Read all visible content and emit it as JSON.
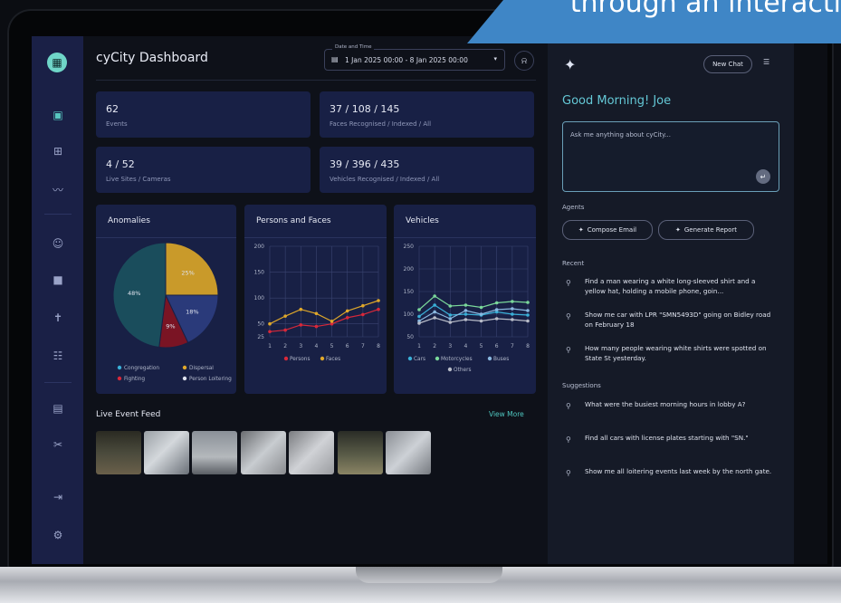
{
  "banner": {
    "text": "through an interacti"
  },
  "app": {
    "title": "cyCity Dashboard"
  },
  "sidebar": {
    "icons": [
      "building-icon",
      "dashboard-icon",
      "grid-icon",
      "trend-icon",
      "face-icon",
      "camera-icon",
      "person-icon",
      "loitering-icon",
      "report-icon",
      "tools-icon",
      "logout-icon",
      "settings-icon"
    ]
  },
  "header": {
    "date_label": "Date and Time",
    "date_value": "1 Jan 2025 00:00 - 8 Jan 2025 00:00"
  },
  "stats": [
    {
      "value": "62",
      "label": "Events"
    },
    {
      "value": "37 / 108 / 145",
      "label": "Faces Recognised / Indexed / All"
    },
    {
      "value": "4 / 52",
      "label": "Live Sites / Cameras"
    },
    {
      "value": "39 / 396 / 435",
      "label": "Vehicles Recognised / Indexed / All"
    }
  ],
  "cards": {
    "anomalies": "Anomalies",
    "persons": "Persons and Faces",
    "vehicles": "Vehicles"
  },
  "colors": {
    "congregation": "#1a4d5c",
    "dispersal": "#c99a2a",
    "fighting": "#7a1424",
    "loitering": "#2a3a7a",
    "persons": "#d8283a",
    "faces": "#e0a82a",
    "cars": "#3ab0d8",
    "motorcycles": "#7ad89a",
    "buses": "#8ab8e0",
    "others": "#b8bcc8"
  },
  "chart_data": [
    {
      "type": "pie",
      "title": "Anomalies",
      "labels": [
        "Congregation",
        "Dispersal",
        "Fighting",
        "Person Loitering"
      ],
      "values": [
        48,
        25,
        9,
        18
      ]
    },
    {
      "type": "line",
      "title": "Persons and Faces",
      "x": [
        1,
        2,
        3,
        4,
        5,
        6,
        7,
        8
      ],
      "ylim": [
        25,
        200
      ],
      "yticks": [
        25,
        50,
        100,
        150,
        200
      ],
      "series": [
        {
          "name": "Persons",
          "values": [
            35,
            38,
            48,
            45,
            50,
            62,
            68,
            78
          ]
        },
        {
          "name": "Faces",
          "values": [
            50,
            65,
            78,
            70,
            55,
            75,
            85,
            95
          ]
        }
      ]
    },
    {
      "type": "line",
      "title": "Vehicles",
      "x": [
        1,
        2,
        3,
        4,
        5,
        6,
        7,
        8
      ],
      "ylim": [
        50,
        250
      ],
      "yticks": [
        50,
        100,
        150,
        200,
        250
      ],
      "series": [
        {
          "name": "Cars",
          "values": [
            95,
            120,
            98,
            100,
            98,
            105,
            100,
            98
          ]
        },
        {
          "name": "Motorcycles",
          "values": [
            110,
            140,
            118,
            120,
            115,
            125,
            128,
            126
          ]
        },
        {
          "name": "Buses",
          "values": [
            85,
            105,
            90,
            108,
            100,
            110,
            112,
            108
          ]
        },
        {
          "name": "Others",
          "values": [
            80,
            92,
            82,
            88,
            85,
            90,
            88,
            85
          ]
        }
      ]
    }
  ],
  "feed": {
    "title": "Live Event Feed",
    "view_more": "View More"
  },
  "chat": {
    "new_chat": "New Chat",
    "greeting": "Good Morning! Joe",
    "placeholder": "Ask me anything about cyCity...",
    "agents_label": "Agents",
    "agents": [
      "Compose Email",
      "Generate Report"
    ],
    "recent_label": "Recent",
    "recent": [
      "Find a man wearing a white long-sleeved shirt and a yellow hat, holding a mobile phone, goin...",
      "Show me car with LPR \"SMN5493D\" going on Bidley road on February 18",
      "How many people wearing white shirts were spotted on State St yesterday."
    ],
    "suggestions_label": "Suggestions",
    "suggestions": [
      "What were the busiest morning hours in lobby A?",
      "Find all cars with license plates starting with \"SN.\"",
      "Show me all loitering events last week by the north gate."
    ]
  }
}
